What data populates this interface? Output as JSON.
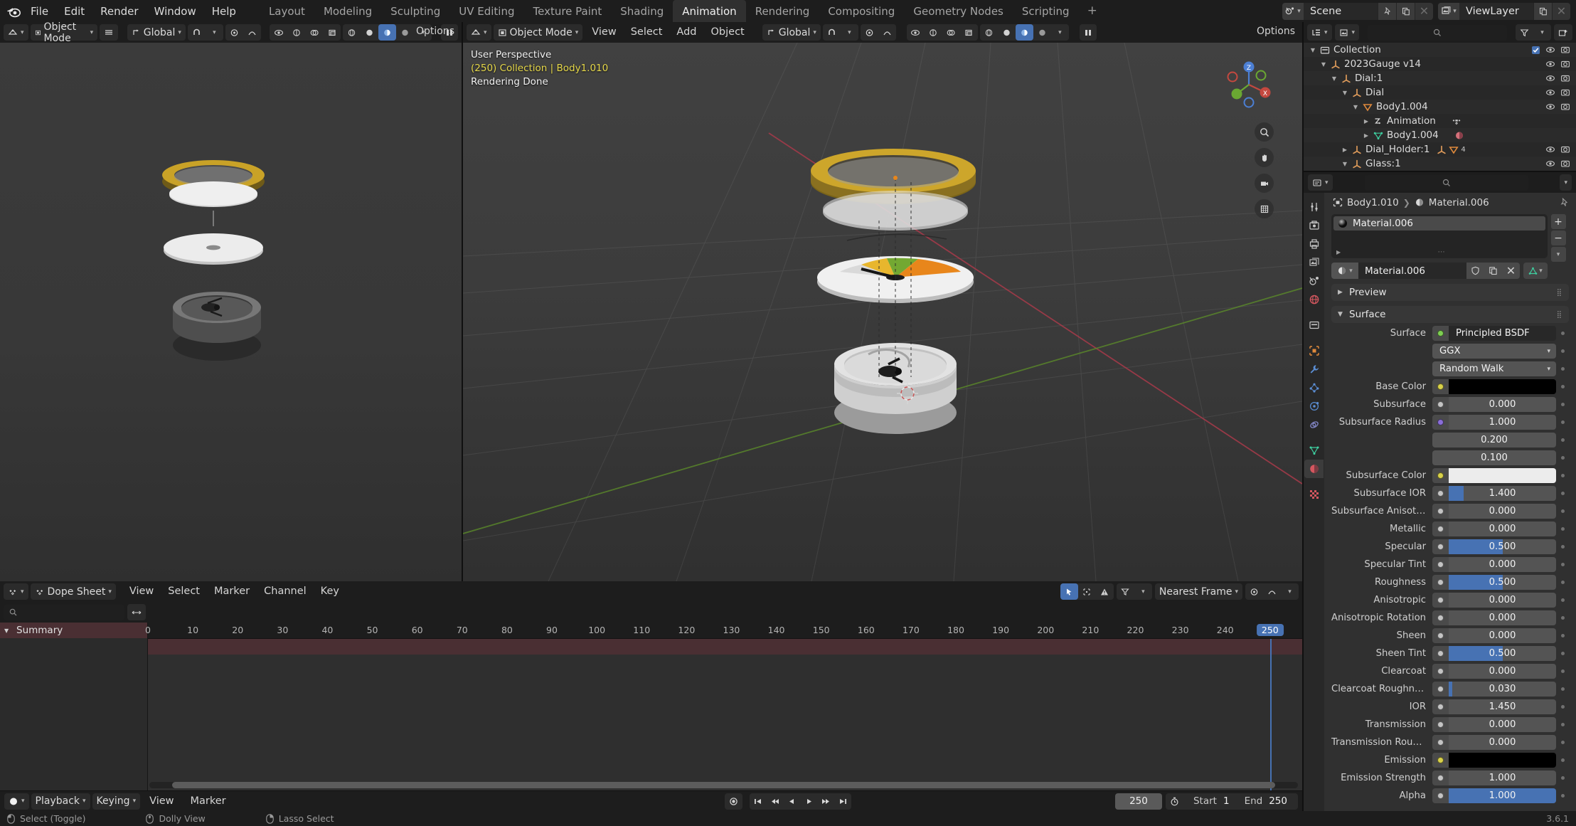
{
  "app": {
    "version": "3.6.1",
    "logo_icon": "blender-logo"
  },
  "topbar": {
    "menus": [
      "File",
      "Edit",
      "Render",
      "Window",
      "Help"
    ],
    "workspaces": [
      {
        "label": "Layout",
        "active": false
      },
      {
        "label": "Modeling",
        "active": false
      },
      {
        "label": "Sculpting",
        "active": false
      },
      {
        "label": "UV Editing",
        "active": false
      },
      {
        "label": "Texture Paint",
        "active": false
      },
      {
        "label": "Shading",
        "active": false
      },
      {
        "label": "Animation",
        "active": true
      },
      {
        "label": "Rendering",
        "active": false
      },
      {
        "label": "Compositing",
        "active": false
      },
      {
        "label": "Geometry Nodes",
        "active": false
      },
      {
        "label": "Scripting",
        "active": false
      }
    ],
    "add_workspace_label": "+",
    "scene": {
      "label": "Scene",
      "icon": "scene-icon",
      "pin_icon": "pin-icon",
      "copy_icon": "duplicate-icon",
      "close_icon": "x-icon"
    },
    "viewlayer": {
      "label": "ViewLayer",
      "icon": "viewlayer-icon",
      "copy_icon": "duplicate-icon",
      "close_icon": "x-icon"
    }
  },
  "viewport_left": {
    "editor_icon": "editor-type-3dview-icon",
    "mode": "Object Mode",
    "orientation": "Global",
    "options_label": "Options",
    "menus": []
  },
  "viewport_right": {
    "editor_icon": "editor-type-3dview-icon",
    "mode": "Object Mode",
    "menus": [
      "View",
      "Select",
      "Add",
      "Object"
    ],
    "orientation": "Global",
    "options_label": "Options",
    "overlay": {
      "view_name": "User Perspective",
      "scene_info": "(250) Collection | Body1.010",
      "status": "Rendering Done"
    },
    "gizmo_axes": [
      "X",
      "Y",
      "Z"
    ],
    "nav_buttons": [
      "zoom-icon",
      "hand-pan-icon",
      "camera-view-icon",
      "ortho-persp-icon"
    ]
  },
  "outliner": {
    "display_mode_icon": "outliner-view-icon",
    "filter_icon": "filter-icon",
    "new_collection_icon": "new-collection-icon",
    "search_placeholder": "",
    "rows": [
      {
        "depth": 0,
        "twirl": "down",
        "icon": "collection-icon",
        "icon_color": "#d0d0d0",
        "name": "Collection",
        "checkbox": true,
        "eye": true,
        "camera": true
      },
      {
        "depth": 1,
        "twirl": "down",
        "icon": "empty-axes-icon",
        "icon_color": "#dd9a5a",
        "name": "2023Gauge v14",
        "checkbox": false,
        "eye": true,
        "camera": true
      },
      {
        "depth": 2,
        "twirl": "down",
        "icon": "empty-axes-icon",
        "icon_color": "#dd9a5a",
        "name": "Dial:1",
        "checkbox": false,
        "eye": true,
        "camera": true
      },
      {
        "depth": 3,
        "twirl": "down",
        "icon": "empty-axes-icon",
        "icon_color": "#dd9a5a",
        "name": "Dial",
        "checkbox": false,
        "eye": true,
        "camera": true
      },
      {
        "depth": 4,
        "twirl": "down",
        "icon": "mesh-object-icon",
        "icon_color": "#e08a3c",
        "name": "Body1.004",
        "checkbox": false,
        "eye": true,
        "camera": true
      },
      {
        "depth": 5,
        "twirl": "right",
        "icon": "animation-icon",
        "icon_color": "#d8d8d8",
        "name": "Animation",
        "checkbox": false,
        "eye": false,
        "camera": false,
        "badge": "action-icon"
      },
      {
        "depth": 5,
        "twirl": "right",
        "icon": "mesh-data-icon",
        "icon_color": "#3ecfa0",
        "name": "Body1.004",
        "checkbox": false,
        "eye": false,
        "camera": false,
        "badge": "material-icon"
      },
      {
        "depth": 3,
        "twirl": "right",
        "icon": "empty-axes-icon",
        "icon_color": "#dd9a5a",
        "name": "Dial_Holder:1",
        "checkbox": false,
        "eye": true,
        "camera": true,
        "badge": "mesh-count-4"
      },
      {
        "depth": 3,
        "twirl": "down",
        "icon": "empty-axes-icon",
        "icon_color": "#dd9a5a",
        "name": "Glass:1",
        "checkbox": false,
        "eye": true,
        "camera": true
      }
    ]
  },
  "properties": {
    "search_placeholder": "",
    "tabs": [
      {
        "name": "tool",
        "icon": "tool-icon",
        "color": "#c8c8c8",
        "active": false
      },
      {
        "name": "render",
        "icon": "render-icon",
        "color": "#c8c8c8",
        "active": false
      },
      {
        "name": "output",
        "icon": "output-icon",
        "color": "#c8c8c8",
        "active": false
      },
      {
        "name": "viewlayer",
        "icon": "viewlayer-icon",
        "color": "#c8c8c8",
        "active": false
      },
      {
        "name": "scene",
        "icon": "scene-props-icon",
        "color": "#c8c8c8",
        "active": false
      },
      {
        "name": "world",
        "icon": "world-icon",
        "color": "#d4575f",
        "active": false
      },
      {
        "name": "collection",
        "icon": "collection-icon",
        "color": "#c8c8c8",
        "active": false
      },
      {
        "name": "object",
        "icon": "object-icon",
        "color": "#e08a3c",
        "active": false
      },
      {
        "name": "modifiers",
        "icon": "wrench-icon",
        "color": "#5b8ed4",
        "active": false
      },
      {
        "name": "particles",
        "icon": "particles-icon",
        "color": "#5b8ed4",
        "active": false
      },
      {
        "name": "physics",
        "icon": "physics-icon",
        "color": "#5b8ed4",
        "active": false
      },
      {
        "name": "constraints",
        "icon": "constraints-icon",
        "color": "#8a8ed4",
        "active": false
      },
      {
        "name": "data",
        "icon": "mesh-data-icon",
        "color": "#3ecfa0",
        "active": false
      },
      {
        "name": "material",
        "icon": "material-icon",
        "color": "#d4575f",
        "active": true
      },
      {
        "name": "texture",
        "icon": "texture-icon",
        "color": "#d4575f",
        "active": false
      }
    ],
    "breadcrumb": {
      "object": "Body1.010",
      "material": "Material.006",
      "object_icon": "object-icon",
      "material_icon": "material-icon",
      "pin_icon": "pin-icon"
    },
    "material_slots": [
      {
        "name": "Material.006",
        "selected": true
      }
    ],
    "slot_buttons": [
      "+",
      "−",
      "chevron-down-icon"
    ],
    "material_datablock": {
      "name": "Material.006",
      "browse_icon": "material-icon",
      "fake_user_icon": "shield-icon",
      "copy_icon": "duplicate-icon",
      "unlink_icon": "x-icon",
      "preview_type_icon": "mesh-data-icon"
    },
    "panels": [
      {
        "name": "Preview",
        "expanded": false
      },
      {
        "name": "Surface",
        "expanded": true
      }
    ],
    "surface": {
      "rows": [
        {
          "label": "Surface",
          "type": "enum",
          "value": "Principled BSDF",
          "dot": "#7ece52",
          "anim": true
        },
        {
          "label": "",
          "type": "dropdown",
          "value": "GGX",
          "dot": null,
          "anim": true
        },
        {
          "label": "",
          "type": "dropdown",
          "value": "Random Walk",
          "dot": null,
          "anim": true
        },
        {
          "label": "Base Color",
          "type": "color",
          "value": "#000000",
          "dot": "#d8d14a",
          "anim": true
        },
        {
          "label": "Subsurface",
          "type": "slider",
          "value": "0.000",
          "fill": 0,
          "dot": "#c4c4c4",
          "anim": true
        },
        {
          "label": "Subsurface Radius",
          "type": "value",
          "value": "1.000",
          "dot": "#8a6ed8",
          "anim": true
        },
        {
          "label": "",
          "type": "value",
          "value": "0.200",
          "dot": null,
          "anim": true
        },
        {
          "label": "",
          "type": "value",
          "value": "0.100",
          "dot": null,
          "anim": true
        },
        {
          "label": "Subsurface Color",
          "type": "color",
          "value": "#ececec",
          "dot": "#d8d14a",
          "anim": true
        },
        {
          "label": "Subsurface IOR",
          "type": "slider",
          "value": "1.400",
          "fill": 14,
          "dot": "#c4c4c4",
          "anim": true
        },
        {
          "label": "Subsurface Anisotropy",
          "type": "slider",
          "value": "0.000",
          "fill": 0,
          "dot": "#c4c4c4",
          "anim": true
        },
        {
          "label": "Metallic",
          "type": "slider",
          "value": "0.000",
          "fill": 0,
          "dot": "#c4c4c4",
          "anim": true
        },
        {
          "label": "Specular",
          "type": "slider",
          "value": "0.500",
          "fill": 50,
          "dot": "#c4c4c4",
          "anim": true
        },
        {
          "label": "Specular Tint",
          "type": "slider",
          "value": "0.000",
          "fill": 0,
          "dot": "#c4c4c4",
          "anim": true
        },
        {
          "label": "Roughness",
          "type": "slider",
          "value": "0.500",
          "fill": 50,
          "dot": "#c4c4c4",
          "anim": true
        },
        {
          "label": "Anisotropic",
          "type": "slider",
          "value": "0.000",
          "fill": 0,
          "dot": "#c4c4c4",
          "anim": true
        },
        {
          "label": "Anisotropic Rotation",
          "type": "slider",
          "value": "0.000",
          "fill": 0,
          "dot": "#c4c4c4",
          "anim": true
        },
        {
          "label": "Sheen",
          "type": "slider",
          "value": "0.000",
          "fill": 0,
          "dot": "#c4c4c4",
          "anim": true
        },
        {
          "label": "Sheen Tint",
          "type": "slider",
          "value": "0.500",
          "fill": 50,
          "dot": "#c4c4c4",
          "anim": true
        },
        {
          "label": "Clearcoat",
          "type": "slider",
          "value": "0.000",
          "fill": 0,
          "dot": "#c4c4c4",
          "anim": true
        },
        {
          "label": "Clearcoat Roughness",
          "type": "slider",
          "value": "0.030",
          "fill": 3,
          "dot": "#c4c4c4",
          "anim": true
        },
        {
          "label": "IOR",
          "type": "slider",
          "value": "1.450",
          "fill": 0,
          "dot": "#c4c4c4",
          "anim": true
        },
        {
          "label": "Transmission",
          "type": "slider",
          "value": "0.000",
          "fill": 0,
          "dot": "#c4c4c4",
          "anim": true
        },
        {
          "label": "Transmission Roughn…",
          "type": "slider",
          "value": "0.000",
          "fill": 0,
          "dot": "#c4c4c4",
          "anim": true
        },
        {
          "label": "Emission",
          "type": "color",
          "value": "#000000",
          "dot": "#d8d14a",
          "anim": true
        },
        {
          "label": "Emission Strength",
          "type": "slider",
          "value": "1.000",
          "fill": 0,
          "dot": "#c4c4c4",
          "anim": true
        },
        {
          "label": "Alpha",
          "type": "slider",
          "value": "1.000",
          "fill": 100,
          "dot": "#c4c4c4",
          "anim": true
        }
      ]
    }
  },
  "dopesheet": {
    "editor_icon": "dopesheet-icon",
    "mode": "Dope Sheet",
    "menus": [
      "View",
      "Select",
      "Marker",
      "Channel",
      "Key"
    ],
    "search_placeholder": "",
    "filter_icon": "filter-icon",
    "snap_mode": "Nearest Frame",
    "proportional_icon": "proportional-edit-icon",
    "falloff_icon": "falloff-icon",
    "channels": [
      {
        "name": "Summary",
        "twirl": "down"
      }
    ],
    "ruler_ticks": [
      0,
      10,
      20,
      30,
      40,
      50,
      60,
      70,
      80,
      90,
      100,
      110,
      120,
      130,
      140,
      150,
      160,
      170,
      180,
      190,
      200,
      210,
      220,
      230,
      240
    ],
    "current_frame": 250,
    "frame_range_start": 0,
    "frame_range_end": 257
  },
  "playbar": {
    "sync_icon": "sync-icon",
    "menus": [
      {
        "label": "Playback",
        "dropdown": true
      },
      {
        "label": "Keying",
        "dropdown": true
      },
      {
        "label": "View",
        "dropdown": false
      },
      {
        "label": "Marker",
        "dropdown": false
      }
    ],
    "record_icon": "record-icon",
    "transport": [
      "jump-start-icon",
      "prev-keyframe-icon",
      "play-reverse-icon",
      "play-icon",
      "next-keyframe-icon",
      "jump-end-icon"
    ],
    "current_frame": "250",
    "timer_icon": "stopwatch-icon",
    "start_label": "Start",
    "start_value": "1",
    "end_label": "End",
    "end_value": "250"
  },
  "statusbar": {
    "items": [
      {
        "icon": "mouse-left-icon",
        "label": "Select (Toggle)"
      },
      {
        "icon": "mouse-middle-icon",
        "label": "Dolly View"
      },
      {
        "icon": "mouse-right-icon",
        "label": "Lasso Select"
      }
    ],
    "version": "3.6.1"
  },
  "colors": {
    "accent_blue": "#4772b3",
    "highlight_yellow": "#e7d94a",
    "header_bg": "#1d1d1d",
    "panel_bg": "#303030",
    "gold": "#c9a227",
    "orange": "#e8861b"
  }
}
